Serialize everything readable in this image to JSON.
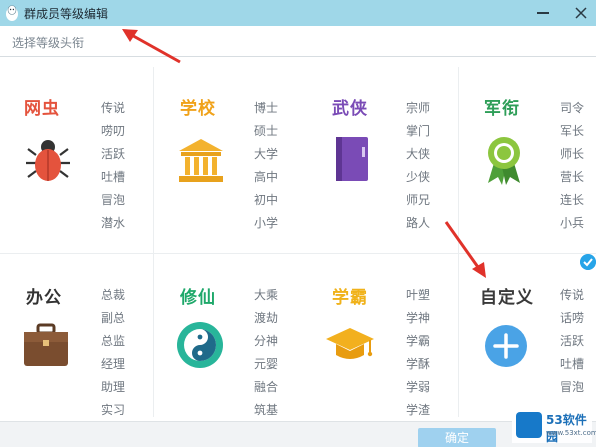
{
  "window": {
    "title": "群成员等级编辑",
    "icon": "penguin-icon"
  },
  "subheader": {
    "label": "选择等级头衔"
  },
  "categories": [
    {
      "id": "wangchong",
      "title": "网虫",
      "color": "#e4533d",
      "icon": "bug-icon",
      "levels": [
        "传说",
        "唠叨",
        "活跃",
        "吐槽",
        "冒泡",
        "潜水"
      ]
    },
    {
      "id": "xuexiao",
      "title": "学校",
      "color": "#f0a21a",
      "icon": "school-building-icon",
      "levels": [
        "博士",
        "硕士",
        "大学",
        "高中",
        "初中",
        "小学"
      ]
    },
    {
      "id": "wuxia",
      "title": "武侠",
      "color": "#7a4bb6",
      "icon": "book-icon",
      "levels": [
        "宗师",
        "掌门",
        "大侠",
        "少侠",
        "师兄",
        "路人"
      ]
    },
    {
      "id": "junxian",
      "title": "军衔",
      "color": "#2e9e58",
      "icon": "medal-icon",
      "levels": [
        "司令",
        "军长",
        "师长",
        "营长",
        "连长",
        "小兵"
      ]
    },
    {
      "id": "bangong",
      "title": "办公",
      "color": "#333333",
      "icon": "briefcase-icon",
      "levels": [
        "总裁",
        "副总",
        "总监",
        "经理",
        "助理",
        "实习"
      ]
    },
    {
      "id": "xiuxian",
      "title": "修仙",
      "color": "#1ea86a",
      "icon": "yin-yang-icon",
      "levels": [
        "大乘",
        "渡劫",
        "分神",
        "元婴",
        "融合",
        "筑基"
      ]
    },
    {
      "id": "xueba",
      "title": "学霸",
      "color": "#f0b21a",
      "icon": "graduation-cap-icon",
      "levels": [
        "叶塑",
        "学神",
        "学霸",
        "学酥",
        "学弱",
        "学渣"
      ]
    },
    {
      "id": "zidingyi",
      "title": "自定义",
      "color": "#3a3a3a",
      "icon": "plus-circle-icon",
      "selected": true,
      "levels": [
        "传说",
        "话唠",
        "活跃",
        "吐槽",
        "冒泡"
      ]
    }
  ],
  "footer": {
    "ok_label": "确定"
  },
  "watermark": {
    "brand": "53软件园",
    "url": "www.53xt.com"
  },
  "colors": {
    "titlebar": "#9fd7e8",
    "accent": "#27a4e8",
    "annotation_arrow": "#e0322a"
  }
}
